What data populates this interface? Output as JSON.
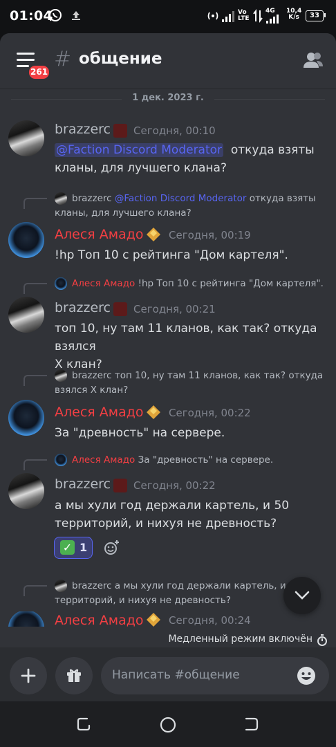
{
  "status_bar": {
    "time": "01:04",
    "net_top": "Vo",
    "net_bottom": "LTE",
    "lte_label": "4G",
    "speed_top": "10,4",
    "speed_bottom": "K/s",
    "battery": "33"
  },
  "header": {
    "badge_count": "261",
    "channel_name": "общение",
    "hash": "#"
  },
  "date_divider": "1 дек. 2023 г.",
  "messages": [
    {
      "author": "brazzerc",
      "timestamp": "Сегодня, 00:10",
      "mention": "@Faction Discord Moderator",
      "line1": "откуда взяты",
      "line2": "кланы, для лучшего клана?"
    },
    {
      "reply_author": "brazzerc",
      "reply_mention": "@Faction Discord Moderator",
      "reply_text1": "откуда взяты",
      "reply_text2": "кланы, для лучшего клана?",
      "author": "Алеся Амадо",
      "timestamp": "Сегодня, 00:19",
      "line1": "!hp Топ 10 с рейтинга \"Дом картеля\"."
    },
    {
      "reply_author": "Алеся Амадо",
      "reply_text1": "!hp Топ 10 с рейтинга \"Дом картеля\".",
      "author": "brazzerc",
      "timestamp": "Сегодня, 00:21",
      "line1": "топ 10, ну там 11 кланов, как так? откуда взялся",
      "line2": "X клан?"
    },
    {
      "reply_author": "brazzerc",
      "reply_text1": "топ 10, ну там 11 кланов, как так? откуда",
      "reply_text2": "взялся X клан?",
      "author": "Алеся Амадо",
      "timestamp": "Сегодня, 00:22",
      "line1": "За \"древность\" на сервере."
    },
    {
      "reply_author": "Алеся Амадо",
      "reply_text1": "За \"древность\" на сервере.",
      "author": "brazzerc",
      "timestamp": "Сегодня, 00:22",
      "line1": "а мы хули год держали картель, и 50",
      "line2": "территорий, и нихуя не древность?",
      "reaction_emoji": "✓",
      "reaction_count": "1"
    },
    {
      "reply_author": "brazzerc",
      "reply_text1": "а мы хули год держали картель, и",
      "reply_text2": "территорий, и нихуя не древность?",
      "author": "Алеся Амадо",
      "timestamp": "Сегодня, 00:24"
    }
  ],
  "slowmode_text": "Медленный режим включён",
  "composer": {
    "placeholder": "Написать #общение"
  },
  "colors": {
    "background": "#313338",
    "accent": "#5865f2",
    "danger": "#f23f43",
    "composer": "#2b2d31"
  },
  "icons": [
    "hamburger-menu-icon",
    "members-icon",
    "plus-icon",
    "gift-icon",
    "emoji-icon",
    "chevron-down-icon",
    "timer-icon",
    "add-reaction-icon"
  ]
}
